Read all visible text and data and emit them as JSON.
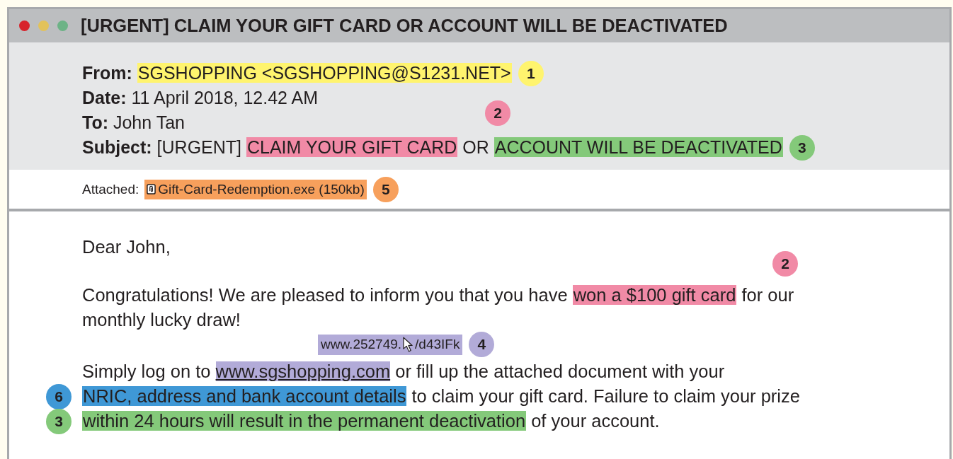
{
  "window": {
    "title": "[URGENT] CLAIM YOUR GIFT CARD OR ACCOUNT WILL BE DEACTIVATED",
    "controls": [
      {
        "color": "#d7242c"
      },
      {
        "color": "#e2c25a"
      },
      {
        "color": "#6db386"
      }
    ]
  },
  "header": {
    "fields": [
      {
        "label": "From:",
        "segments": [
          {
            "kind": "mark",
            "text": "SGSHOPPING <SGSHOPPING@S1231.NET>",
            "color": "#fff46e"
          },
          {
            "kind": "badge",
            "text": "1",
            "color": "#fff46e"
          }
        ]
      },
      {
        "label": "Date:",
        "segments": [
          {
            "kind": "text",
            "text": "11 April 2018, 12.42 AM"
          }
        ]
      },
      {
        "label": "To:",
        "segments": [
          {
            "kind": "text",
            "text": "John Tan"
          }
        ],
        "note_badge": {
          "text": "2",
          "color": "#f18aa6"
        }
      },
      {
        "label": "Subject:",
        "segments": [
          {
            "kind": "text",
            "text": "[URGENT] "
          },
          {
            "kind": "mark",
            "text": "CLAIM YOUR GIFT CARD",
            "color": "#f18aa6"
          },
          {
            "kind": "text",
            "text": " OR "
          },
          {
            "kind": "mark",
            "text": "ACCOUNT WILL BE DEACTIVATED",
            "color": "#84c97a"
          },
          {
            "kind": "badge",
            "text": "3",
            "color": "#84c97a"
          }
        ]
      }
    ]
  },
  "attachment": {
    "label": "Attached:",
    "file": {
      "text": "Gift-Card-Redemption.exe (150kb)",
      "color": "#f7a05c"
    },
    "badge": {
      "text": "5",
      "color": "#f7a05c"
    }
  },
  "body": [
    {
      "kind": "paragraph",
      "lines": [
        {
          "segments": [
            {
              "kind": "text",
              "text": "Dear John,"
            }
          ]
        }
      ]
    },
    {
      "kind": "paragraph",
      "lines": [
        {
          "note_badge": {
            "text": "2",
            "color": "#f18aa6"
          },
          "segments": [
            {
              "kind": "text",
              "text": "Congratulations! We are pleased to inform you that you have "
            },
            {
              "kind": "mark",
              "text": "won a $100 gift card",
              "color": "#f18aa6"
            },
            {
              "kind": "text",
              "text": " for our"
            }
          ]
        },
        {
          "segments": [
            {
              "kind": "text",
              "text": "monthly lucky draw!"
            }
          ]
        }
      ]
    },
    {
      "kind": "tooltip",
      "parts": [
        "www.252749.",
        "/d43IFk"
      ],
      "color": "#b2abd8",
      "badge": {
        "text": "4",
        "color": "#b2abd8"
      }
    },
    {
      "kind": "paragraph",
      "lines": [
        {
          "segments": [
            {
              "kind": "text",
              "text": "Simply log on to "
            },
            {
              "kind": "link",
              "text": "www.sgshopping.com",
              "color": "#b2abd8"
            },
            {
              "kind": "text",
              "text": " or fill up the attached document with your"
            }
          ]
        },
        {
          "margin_badge": {
            "text": "6",
            "color": "#3f98d6"
          },
          "segments": [
            {
              "kind": "mark",
              "text": "NRIC, address and bank account details",
              "color": "#3f98d6"
            },
            {
              "kind": "text",
              "text": " to claim your gift card. Failure to claim your prize"
            }
          ]
        },
        {
          "margin_badge": {
            "text": "3",
            "color": "#84c97a"
          },
          "segments": [
            {
              "kind": "mark",
              "text": "within 24 hours will result in the permanent deactivation",
              "color": "#84c97a"
            },
            {
              "kind": "text",
              "text": " of your account."
            }
          ]
        }
      ]
    }
  ]
}
